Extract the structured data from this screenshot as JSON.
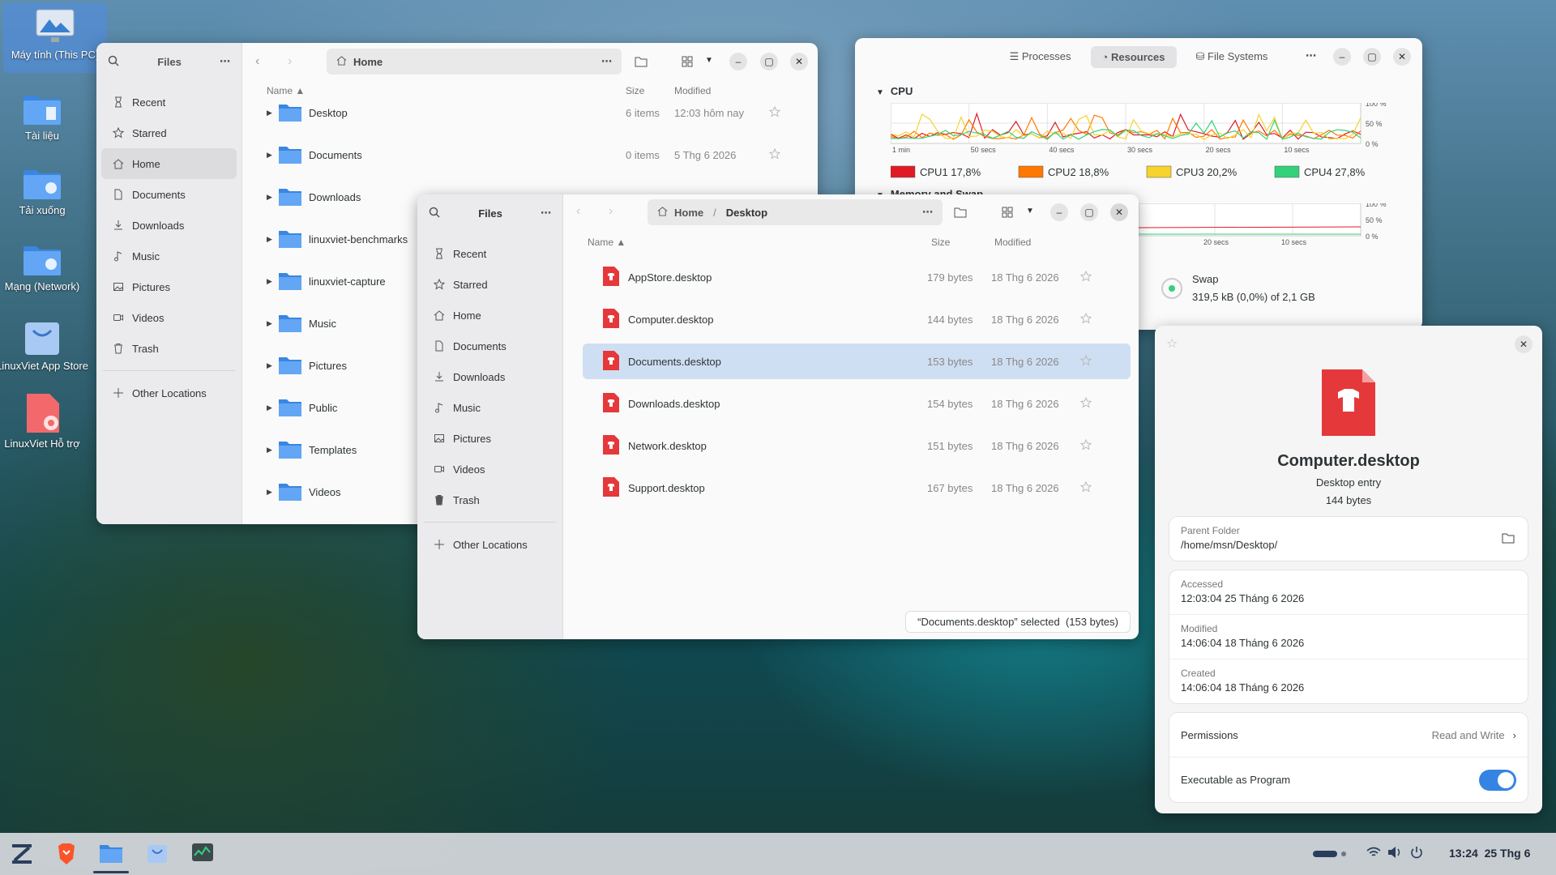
{
  "desktop": {
    "icons": [
      {
        "label": "Máy tính (This PC)"
      },
      {
        "label": "Tài liệu"
      },
      {
        "label": "Tải xuống"
      },
      {
        "label": "Mạng (Network)"
      },
      {
        "label": "LinuxViet App Store"
      },
      {
        "label": "LinuxViet Hỗ trợ"
      }
    ]
  },
  "files_back": {
    "title": "Files",
    "path": "Home",
    "sidebar": [
      "Recent",
      "Starred",
      "Home",
      "Documents",
      "Downloads",
      "Music",
      "Pictures",
      "Videos",
      "Trash"
    ],
    "other_locations": "Other Locations",
    "columns": {
      "name": "Name",
      "size": "Size",
      "modified": "Modified"
    },
    "rows": [
      {
        "name": "Desktop",
        "size": "6 items",
        "modified": "12:03 hôm nay"
      },
      {
        "name": "Documents",
        "size": "0 items",
        "modified": "5 Thg 6 2026"
      },
      {
        "name": "Downloads",
        "size": "",
        "modified": ""
      },
      {
        "name": "linuxviet-benchmarks",
        "size": "",
        "modified": ""
      },
      {
        "name": "linuxviet-capture",
        "size": "",
        "modified": ""
      },
      {
        "name": "Music",
        "size": "",
        "modified": ""
      },
      {
        "name": "Pictures",
        "size": "",
        "modified": ""
      },
      {
        "name": "Public",
        "size": "",
        "modified": ""
      },
      {
        "name": "Templates",
        "size": "",
        "modified": ""
      },
      {
        "name": "Videos",
        "size": "",
        "modified": ""
      }
    ]
  },
  "files_front": {
    "title": "Files",
    "path": [
      "Home",
      "Desktop"
    ],
    "sidebar": [
      "Recent",
      "Starred",
      "Home",
      "Documents",
      "Downloads",
      "Music",
      "Pictures",
      "Videos",
      "Trash"
    ],
    "other_locations": "Other Locations",
    "columns": {
      "name": "Name",
      "size": "Size",
      "modified": "Modified"
    },
    "rows": [
      {
        "name": "AppStore.desktop",
        "size": "179 bytes",
        "modified": "18 Thg 6 2026"
      },
      {
        "name": "Computer.desktop",
        "size": "144 bytes",
        "modified": "18 Thg 6 2026"
      },
      {
        "name": "Documents.desktop",
        "size": "153 bytes",
        "modified": "18 Thg 6 2026"
      },
      {
        "name": "Downloads.desktop",
        "size": "154 bytes",
        "modified": "18 Thg 6 2026"
      },
      {
        "name": "Network.desktop",
        "size": "151 bytes",
        "modified": "18 Thg 6 2026"
      },
      {
        "name": "Support.desktop",
        "size": "167 bytes",
        "modified": "18 Thg 6 2026"
      }
    ],
    "selected_index": 2,
    "status": "“Documents.desktop” selected  (153 bytes)"
  },
  "monitor": {
    "tabs": [
      "Processes",
      "Resources",
      "File Systems"
    ],
    "active_tab": "Resources",
    "cpu_title": "CPU",
    "mem_title": "Memory and Swap",
    "x_ticks": [
      "1 min",
      "50 secs",
      "40 secs",
      "30 secs",
      "20 secs",
      "10 secs"
    ],
    "mem_x_ticks": [
      "20 secs",
      "10 secs"
    ],
    "y_ticks": [
      "100 %",
      "50 %",
      "0 %"
    ],
    "cpus": [
      {
        "name": "CPU1",
        "value": "17,8%",
        "color": "#e01b24"
      },
      {
        "name": "CPU2",
        "value": "18,8%",
        "color": "#ff7800"
      },
      {
        "name": "CPU3",
        "value": "20,2%",
        "color": "#f6d32d"
      },
      {
        "name": "CPU4",
        "value": "27,8%",
        "color": "#33d17a"
      }
    ],
    "swap_label": "Swap",
    "swap_value": "319,5 kB (0,0%) of 2,1 GB"
  },
  "properties": {
    "name": "Computer.desktop",
    "type": "Desktop entry",
    "size": "144 bytes",
    "parent_label": "Parent Folder",
    "parent_value": "/home/msn/Desktop/",
    "accessed_label": "Accessed",
    "accessed_value": "12:03:04 25 Tháng 6 2026",
    "modified_label": "Modified",
    "modified_value": "14:06:04 18 Tháng 6 2026",
    "created_label": "Created",
    "created_value": "14:06:04 18 Tháng 6 2026",
    "permissions_label": "Permissions",
    "permissions_value": "Read and Write",
    "exec_label": "Executable as Program",
    "exec_on": true,
    "accent": "#3584e4"
  },
  "taskbar": {
    "clock": "13:24  25 Thg 6"
  }
}
